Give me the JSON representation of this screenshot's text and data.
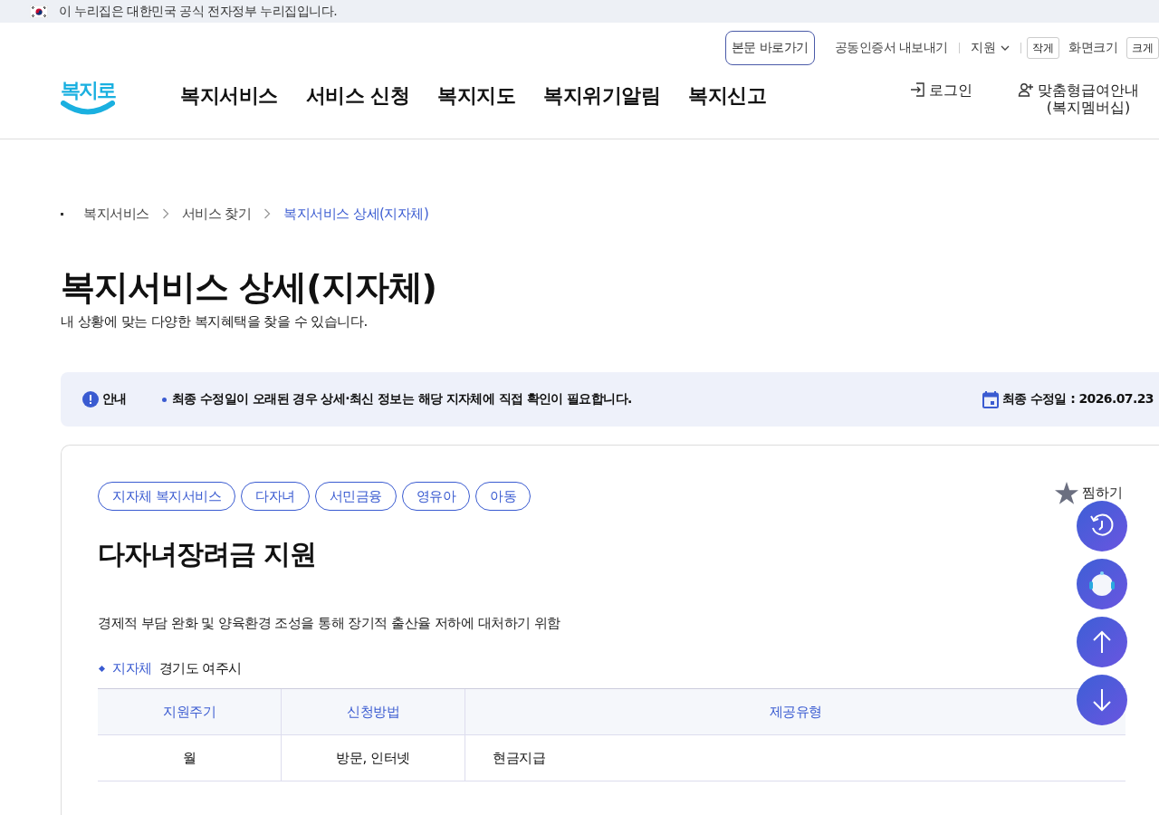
{
  "gov_banner": {
    "text": "이 누리집은 대한민국 공식 전자정부 누리집입니다."
  },
  "header": {
    "logo": "복지로",
    "utility": [
      {
        "kind": "skip",
        "label": "본문 바로가기"
      },
      {
        "kind": "link",
        "label": "공동인증서 내보내기"
      },
      {
        "kind": "dropdown",
        "label": "지원"
      },
      {
        "kind": "size",
        "label": "작게"
      },
      {
        "kind": "text",
        "label": "화면크기"
      },
      {
        "kind": "size",
        "label": "크게"
      }
    ],
    "nav": [
      "복지서비스",
      "서비스 신청",
      "복지지도",
      "복지위기알림",
      "복지신고"
    ],
    "account": [
      {
        "kind": "login",
        "lines": [
          "로그인"
        ]
      },
      {
        "kind": "join",
        "lines": [
          "맞춤형급여안내",
          "(복지멤버십)"
        ]
      }
    ]
  },
  "breadcrumb": [
    {
      "label": "복지서비스",
      "selected": false
    },
    {
      "label": "서비스 찾기",
      "selected": false
    },
    {
      "label": "복지서비스 상세(지자체)",
      "selected": true
    }
  ],
  "page": {
    "title": "복지서비스 상세(지자체)",
    "subtitle": "내 상황에 맞는 다양한 복지혜택을 찾을 수 있습니다."
  },
  "notice": {
    "label": "안내",
    "message": "최종 수정일이 오래된 경우 상세·최신 정보는 해당 지자체에 직접 확인이 필요합니다.",
    "date": "최종 수정일 : 2026.07.23"
  },
  "card": {
    "tags": [
      "지자체 복지서비스",
      "다자녀",
      "서민금융",
      "영유아",
      "아동"
    ],
    "favorite": {
      "label": "찜하기",
      "on": false
    },
    "title": "다자녀장려금 지원",
    "description": "경제적 부담 완화 및 양육환경 조성을 통해 장기적 출산율 저하에 대처하기 위함",
    "region": {
      "label": "지자체",
      "value": "경기도 여주시"
    },
    "table": {
      "columns": [
        "지원주기",
        "신청방법",
        "제공유형"
      ],
      "rows": [
        [
          "월",
          "방문, 인터넷",
          "현금지급"
        ]
      ]
    }
  },
  "floating": [
    {
      "kind": "history"
    },
    {
      "kind": "chatbot"
    },
    {
      "kind": "up"
    },
    {
      "kind": "down"
    }
  ]
}
